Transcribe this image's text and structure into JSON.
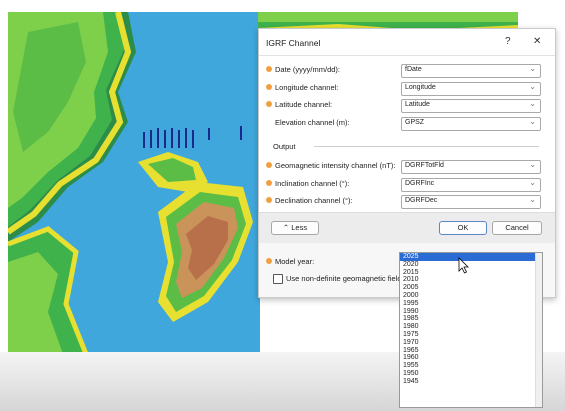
{
  "dialog": {
    "title": "IGRF Channel",
    "help_label": "?",
    "close_label": "✕",
    "fields": [
      {
        "label": "Date (yyyy/mm/dd):",
        "value": "fDate",
        "required": true
      },
      {
        "label": "Longitude channel:",
        "value": "Longitude",
        "required": true
      },
      {
        "label": "Latitude channel:",
        "value": "Latitude",
        "required": true
      },
      {
        "label": "Elevation channel (m):",
        "value": "GPSZ",
        "required": false
      }
    ],
    "output_label": "Output",
    "outputs": [
      {
        "label": "Geomagnetic intensity channel (nT):",
        "value": "DGRFTotFld"
      },
      {
        "label": "Inclination channel (°):",
        "value": "DGRFInc"
      },
      {
        "label": "Declination channel (°):",
        "value": "DGRFDec"
      }
    ],
    "less_icon": "double-chevron-up-icon",
    "less_label": "Less",
    "ok_label": "OK",
    "cancel_label": "Cancel",
    "model_year_label": "Model year:",
    "checkbox_label": "Use non-definite geomagnetic field",
    "model_year_options": [
      "2025",
      "2020",
      "2015",
      "2010",
      "2005",
      "2000",
      "1995",
      "1990",
      "1985",
      "1980",
      "1975",
      "1970",
      "1965",
      "1960",
      "1955",
      "1950",
      "1945"
    ],
    "selected_year": "2025"
  },
  "colors": {
    "required_marker": "#f0a040",
    "selection": "#2a6cd4",
    "ok_border": "#5b87c9",
    "map_sea": "#3aa0d8",
    "map_land_high": "#b8704a",
    "map_coast": "#e8e030"
  }
}
